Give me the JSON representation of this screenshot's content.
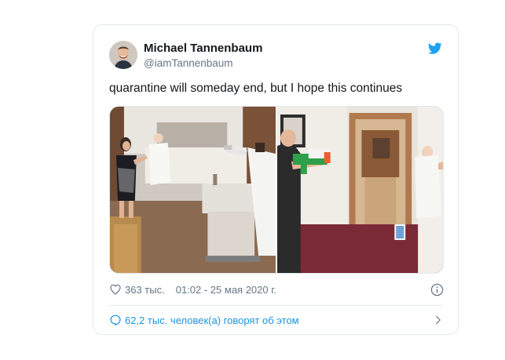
{
  "tweet": {
    "author_name": "Michael Tannenbaum",
    "author_handle": "@iamTannenbaum",
    "text": "quarantine will someday end, but I hope this continues",
    "likes": "363 тыс.",
    "timestamp": "01:02 - 25 мая 2020 г.",
    "conversation": "62,2 тыс. человек(а) говорят об этом"
  },
  "media": {
    "count": 2
  },
  "icons": {
    "brand": "twitter-bird-icon",
    "like": "heart-icon",
    "info": "info-icon",
    "reply": "speech-bubble-icon",
    "more": "chevron-right-icon"
  },
  "colors": {
    "twitter_blue": "#1da1f2",
    "link_blue": "#1b95e0",
    "text_primary": "#14171a",
    "text_secondary": "#657786",
    "border": "#e1e8ed"
  }
}
